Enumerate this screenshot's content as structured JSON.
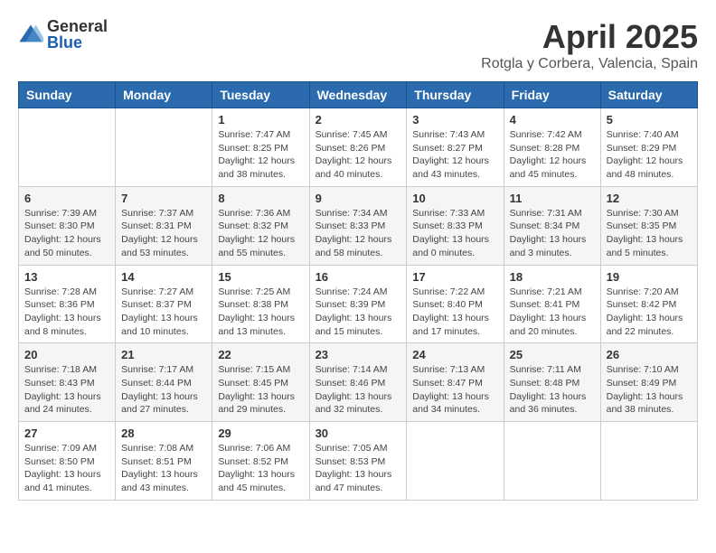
{
  "logo": {
    "general": "General",
    "blue": "Blue"
  },
  "title": "April 2025",
  "subtitle": "Rotgla y Corbera, Valencia, Spain",
  "days_of_week": [
    "Sunday",
    "Monday",
    "Tuesday",
    "Wednesday",
    "Thursday",
    "Friday",
    "Saturday"
  ],
  "weeks": [
    [
      {
        "day": "",
        "info": ""
      },
      {
        "day": "",
        "info": ""
      },
      {
        "day": "1",
        "info": "Sunrise: 7:47 AM\nSunset: 8:25 PM\nDaylight: 12 hours and 38 minutes."
      },
      {
        "day": "2",
        "info": "Sunrise: 7:45 AM\nSunset: 8:26 PM\nDaylight: 12 hours and 40 minutes."
      },
      {
        "day": "3",
        "info": "Sunrise: 7:43 AM\nSunset: 8:27 PM\nDaylight: 12 hours and 43 minutes."
      },
      {
        "day": "4",
        "info": "Sunrise: 7:42 AM\nSunset: 8:28 PM\nDaylight: 12 hours and 45 minutes."
      },
      {
        "day": "5",
        "info": "Sunrise: 7:40 AM\nSunset: 8:29 PM\nDaylight: 12 hours and 48 minutes."
      }
    ],
    [
      {
        "day": "6",
        "info": "Sunrise: 7:39 AM\nSunset: 8:30 PM\nDaylight: 12 hours and 50 minutes."
      },
      {
        "day": "7",
        "info": "Sunrise: 7:37 AM\nSunset: 8:31 PM\nDaylight: 12 hours and 53 minutes."
      },
      {
        "day": "8",
        "info": "Sunrise: 7:36 AM\nSunset: 8:32 PM\nDaylight: 12 hours and 55 minutes."
      },
      {
        "day": "9",
        "info": "Sunrise: 7:34 AM\nSunset: 8:33 PM\nDaylight: 12 hours and 58 minutes."
      },
      {
        "day": "10",
        "info": "Sunrise: 7:33 AM\nSunset: 8:33 PM\nDaylight: 13 hours and 0 minutes."
      },
      {
        "day": "11",
        "info": "Sunrise: 7:31 AM\nSunset: 8:34 PM\nDaylight: 13 hours and 3 minutes."
      },
      {
        "day": "12",
        "info": "Sunrise: 7:30 AM\nSunset: 8:35 PM\nDaylight: 13 hours and 5 minutes."
      }
    ],
    [
      {
        "day": "13",
        "info": "Sunrise: 7:28 AM\nSunset: 8:36 PM\nDaylight: 13 hours and 8 minutes."
      },
      {
        "day": "14",
        "info": "Sunrise: 7:27 AM\nSunset: 8:37 PM\nDaylight: 13 hours and 10 minutes."
      },
      {
        "day": "15",
        "info": "Sunrise: 7:25 AM\nSunset: 8:38 PM\nDaylight: 13 hours and 13 minutes."
      },
      {
        "day": "16",
        "info": "Sunrise: 7:24 AM\nSunset: 8:39 PM\nDaylight: 13 hours and 15 minutes."
      },
      {
        "day": "17",
        "info": "Sunrise: 7:22 AM\nSunset: 8:40 PM\nDaylight: 13 hours and 17 minutes."
      },
      {
        "day": "18",
        "info": "Sunrise: 7:21 AM\nSunset: 8:41 PM\nDaylight: 13 hours and 20 minutes."
      },
      {
        "day": "19",
        "info": "Sunrise: 7:20 AM\nSunset: 8:42 PM\nDaylight: 13 hours and 22 minutes."
      }
    ],
    [
      {
        "day": "20",
        "info": "Sunrise: 7:18 AM\nSunset: 8:43 PM\nDaylight: 13 hours and 24 minutes."
      },
      {
        "day": "21",
        "info": "Sunrise: 7:17 AM\nSunset: 8:44 PM\nDaylight: 13 hours and 27 minutes."
      },
      {
        "day": "22",
        "info": "Sunrise: 7:15 AM\nSunset: 8:45 PM\nDaylight: 13 hours and 29 minutes."
      },
      {
        "day": "23",
        "info": "Sunrise: 7:14 AM\nSunset: 8:46 PM\nDaylight: 13 hours and 32 minutes."
      },
      {
        "day": "24",
        "info": "Sunrise: 7:13 AM\nSunset: 8:47 PM\nDaylight: 13 hours and 34 minutes."
      },
      {
        "day": "25",
        "info": "Sunrise: 7:11 AM\nSunset: 8:48 PM\nDaylight: 13 hours and 36 minutes."
      },
      {
        "day": "26",
        "info": "Sunrise: 7:10 AM\nSunset: 8:49 PM\nDaylight: 13 hours and 38 minutes."
      }
    ],
    [
      {
        "day": "27",
        "info": "Sunrise: 7:09 AM\nSunset: 8:50 PM\nDaylight: 13 hours and 41 minutes."
      },
      {
        "day": "28",
        "info": "Sunrise: 7:08 AM\nSunset: 8:51 PM\nDaylight: 13 hours and 43 minutes."
      },
      {
        "day": "29",
        "info": "Sunrise: 7:06 AM\nSunset: 8:52 PM\nDaylight: 13 hours and 45 minutes."
      },
      {
        "day": "30",
        "info": "Sunrise: 7:05 AM\nSunset: 8:53 PM\nDaylight: 13 hours and 47 minutes."
      },
      {
        "day": "",
        "info": ""
      },
      {
        "day": "",
        "info": ""
      },
      {
        "day": "",
        "info": ""
      }
    ]
  ]
}
